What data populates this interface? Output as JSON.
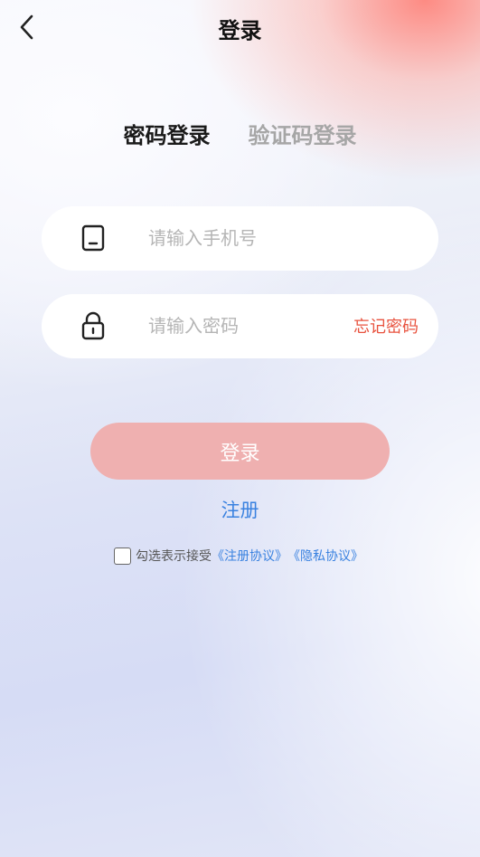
{
  "header": {
    "title": "登录",
    "back_icon": "chevron-left-icon"
  },
  "tabs": [
    {
      "label": "密码登录",
      "active": true
    },
    {
      "label": "验证码登录",
      "active": false
    }
  ],
  "phone_field": {
    "icon": "phone-icon",
    "placeholder": "请输入手机号",
    "value": ""
  },
  "password_field": {
    "icon": "lock-icon",
    "placeholder": "请输入密码",
    "value": "",
    "forgot_label": "忘记密码"
  },
  "login_button": {
    "label": "登录"
  },
  "register_link": {
    "label": "注册"
  },
  "agreement": {
    "checked": false,
    "text": "勾选表示接受",
    "terms_link": "《注册协议》",
    "privacy_link": "《隐私协议》"
  },
  "colors": {
    "accent_blue": "#3a82e0",
    "accent_red": "#e8533f",
    "button_disabled": "#efb0b0"
  }
}
